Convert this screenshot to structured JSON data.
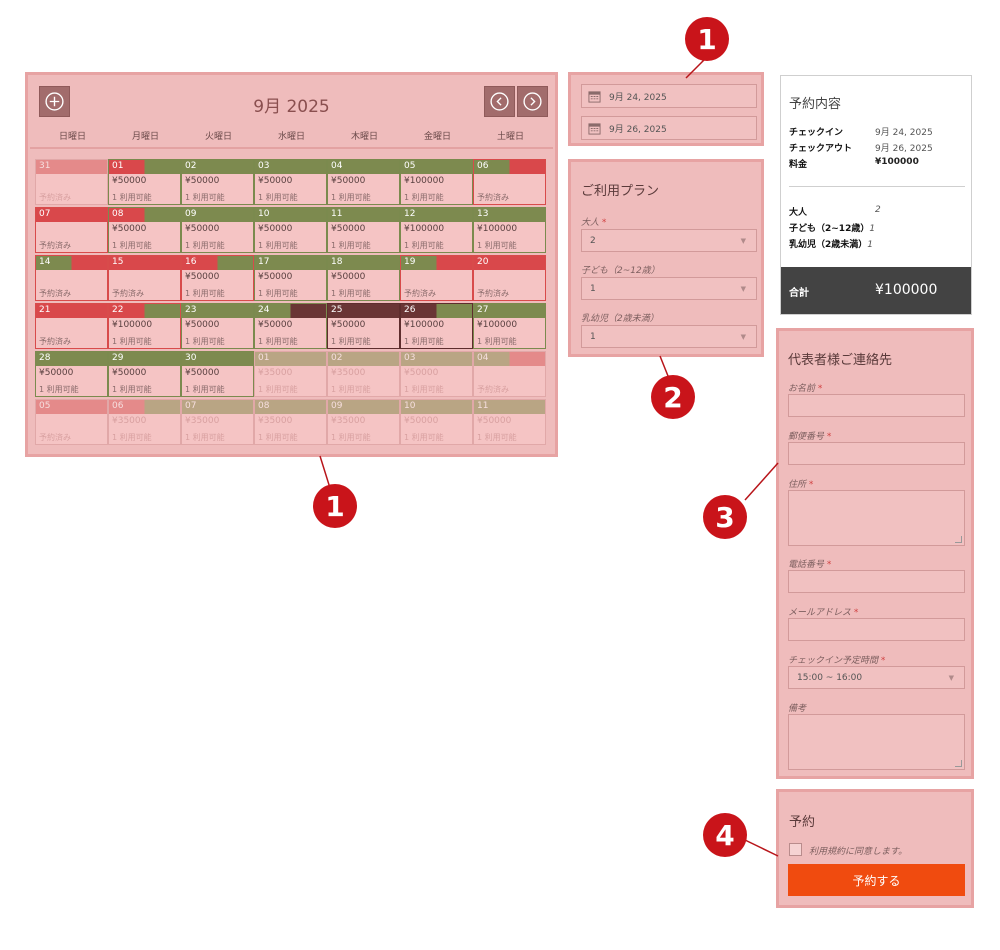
{
  "calendar": {
    "title": "9月 2025",
    "weekdays": [
      "日曜日",
      "月曜日",
      "火曜日",
      "水曜日",
      "木曜日",
      "金曜日",
      "土曜日"
    ],
    "colors": {
      "available": "#7d8a4f",
      "booked": "#d9484b",
      "selected": "#6a3535",
      "out_booked": "#e48a8a",
      "out_available": "#b9a584"
    },
    "weeks": [
      [
        {
          "d": "31",
          "price": "",
          "stat": "予約済み",
          "kind": "out",
          "bar": [
            [
              "out_booked",
              1
            ]
          ]
        },
        {
          "d": "01",
          "price": "¥50000",
          "stat": "1 利用可能",
          "kind": "avail",
          "bar": [
            [
              "booked",
              0.5
            ],
            [
              "available",
              0.5
            ]
          ]
        },
        {
          "d": "02",
          "price": "¥50000",
          "stat": "1 利用可能",
          "kind": "avail",
          "bar": [
            [
              "available",
              1
            ]
          ]
        },
        {
          "d": "03",
          "price": "¥50000",
          "stat": "1 利用可能",
          "kind": "avail",
          "bar": [
            [
              "available",
              1
            ]
          ]
        },
        {
          "d": "04",
          "price": "¥50000",
          "stat": "1 利用可能",
          "kind": "avail",
          "bar": [
            [
              "available",
              1
            ]
          ]
        },
        {
          "d": "05",
          "price": "¥100000",
          "stat": "1 利用可能",
          "kind": "avail",
          "bar": [
            [
              "available",
              1
            ]
          ]
        },
        {
          "d": "06",
          "price": "",
          "stat": "予約済み",
          "kind": "booked",
          "bar": [
            [
              "available",
              0.5
            ],
            [
              "booked",
              0.5
            ]
          ]
        }
      ],
      [
        {
          "d": "07",
          "price": "",
          "stat": "予約済み",
          "kind": "booked",
          "bar": [
            [
              "booked",
              1
            ]
          ]
        },
        {
          "d": "08",
          "price": "¥50000",
          "stat": "1 利用可能",
          "kind": "avail",
          "bar": [
            [
              "booked",
              0.5
            ],
            [
              "available",
              0.5
            ]
          ]
        },
        {
          "d": "09",
          "price": "¥50000",
          "stat": "1 利用可能",
          "kind": "avail",
          "bar": [
            [
              "available",
              1
            ]
          ]
        },
        {
          "d": "10",
          "price": "¥50000",
          "stat": "1 利用可能",
          "kind": "avail",
          "bar": [
            [
              "available",
              1
            ]
          ]
        },
        {
          "d": "11",
          "price": "¥50000",
          "stat": "1 利用可能",
          "kind": "avail",
          "bar": [
            [
              "available",
              1
            ]
          ]
        },
        {
          "d": "12",
          "price": "¥100000",
          "stat": "1 利用可能",
          "kind": "avail",
          "bar": [
            [
              "available",
              1
            ]
          ]
        },
        {
          "d": "13",
          "price": "¥100000",
          "stat": "1 利用可能",
          "kind": "avail",
          "bar": [
            [
              "available",
              1
            ]
          ]
        }
      ],
      [
        {
          "d": "14",
          "price": "",
          "stat": "予約済み",
          "kind": "booked",
          "bar": [
            [
              "available",
              0.5
            ],
            [
              "booked",
              0.5
            ]
          ]
        },
        {
          "d": "15",
          "price": "",
          "stat": "予約済み",
          "kind": "booked",
          "bar": [
            [
              "booked",
              1
            ]
          ]
        },
        {
          "d": "16",
          "price": "¥50000",
          "stat": "1 利用可能",
          "kind": "booked",
          "bar": [
            [
              "booked",
              0.5
            ],
            [
              "available",
              0.5
            ]
          ]
        },
        {
          "d": "17",
          "price": "¥50000",
          "stat": "1 利用可能",
          "kind": "avail",
          "bar": [
            [
              "available",
              1
            ]
          ]
        },
        {
          "d": "18",
          "price": "¥50000",
          "stat": "1 利用可能",
          "kind": "avail",
          "bar": [
            [
              "available",
              1
            ]
          ]
        },
        {
          "d": "19",
          "price": "",
          "stat": "予約済み",
          "kind": "booked",
          "bar": [
            [
              "available",
              0.5
            ],
            [
              "booked",
              0.5
            ]
          ]
        },
        {
          "d": "20",
          "price": "",
          "stat": "予約済み",
          "kind": "booked",
          "bar": [
            [
              "booked",
              1
            ]
          ]
        }
      ],
      [
        {
          "d": "21",
          "price": "",
          "stat": "予約済み",
          "kind": "booked",
          "bar": [
            [
              "booked",
              1
            ]
          ]
        },
        {
          "d": "22",
          "price": "¥100000",
          "stat": "1 利用可能",
          "kind": "booked",
          "bar": [
            [
              "booked",
              0.5
            ],
            [
              "available",
              0.5
            ]
          ]
        },
        {
          "d": "23",
          "price": "¥50000",
          "stat": "1 利用可能",
          "kind": "avail",
          "bar": [
            [
              "available",
              1
            ]
          ]
        },
        {
          "d": "24",
          "price": "¥50000",
          "stat": "1 利用可能",
          "kind": "avail",
          "bar": [
            [
              "available",
              0.5
            ],
            [
              "selected",
              0.5
            ]
          ]
        },
        {
          "d": "25",
          "price": "¥50000",
          "stat": "1 利用可能",
          "kind": "sel",
          "bar": [
            [
              "selected",
              1
            ]
          ]
        },
        {
          "d": "26",
          "price": "¥100000",
          "stat": "1 利用可能",
          "kind": "sel",
          "bar": [
            [
              "selected",
              0.5
            ],
            [
              "available",
              0.5
            ]
          ]
        },
        {
          "d": "27",
          "price": "¥100000",
          "stat": "1 利用可能",
          "kind": "avail",
          "bar": [
            [
              "available",
              1
            ]
          ]
        }
      ],
      [
        {
          "d": "28",
          "price": "¥50000",
          "stat": "1 利用可能",
          "kind": "avail",
          "bar": [
            [
              "available",
              1
            ]
          ]
        },
        {
          "d": "29",
          "price": "¥50000",
          "stat": "1 利用可能",
          "kind": "avail",
          "bar": [
            [
              "available",
              1
            ]
          ]
        },
        {
          "d": "30",
          "price": "¥50000",
          "stat": "1 利用可能",
          "kind": "avail",
          "bar": [
            [
              "available",
              1
            ]
          ]
        },
        {
          "d": "01",
          "price": "¥35000",
          "stat": "1 利用可能",
          "kind": "out",
          "bar": [
            [
              "out_available",
              1
            ]
          ]
        },
        {
          "d": "02",
          "price": "¥35000",
          "stat": "1 利用可能",
          "kind": "out",
          "bar": [
            [
              "out_available",
              1
            ]
          ]
        },
        {
          "d": "03",
          "price": "¥50000",
          "stat": "1 利用可能",
          "kind": "out",
          "bar": [
            [
              "out_available",
              1
            ]
          ]
        },
        {
          "d": "04",
          "price": "",
          "stat": "予約済み",
          "kind": "out",
          "bar": [
            [
              "out_available",
              0.5
            ],
            [
              "out_booked",
              0.5
            ]
          ]
        }
      ],
      [
        {
          "d": "05",
          "price": "",
          "stat": "予約済み",
          "kind": "out",
          "bar": [
            [
              "out_booked",
              1
            ]
          ]
        },
        {
          "d": "06",
          "price": "¥35000",
          "stat": "1 利用可能",
          "kind": "out",
          "bar": [
            [
              "out_booked",
              0.5
            ],
            [
              "out_available",
              0.5
            ]
          ]
        },
        {
          "d": "07",
          "price": "¥35000",
          "stat": "1 利用可能",
          "kind": "out",
          "bar": [
            [
              "out_available",
              1
            ]
          ]
        },
        {
          "d": "08",
          "price": "¥35000",
          "stat": "1 利用可能",
          "kind": "out",
          "bar": [
            [
              "out_available",
              1
            ]
          ]
        },
        {
          "d": "09",
          "price": "¥35000",
          "stat": "1 利用可能",
          "kind": "out",
          "bar": [
            [
              "out_available",
              1
            ]
          ]
        },
        {
          "d": "10",
          "price": "¥50000",
          "stat": "1 利用可能",
          "kind": "out",
          "bar": [
            [
              "out_available",
              1
            ]
          ]
        },
        {
          "d": "11",
          "price": "¥50000",
          "stat": "1 利用可能",
          "kind": "out",
          "bar": [
            [
              "out_available",
              1
            ]
          ]
        }
      ]
    ]
  },
  "dates": {
    "checkin": "9月 24, 2025",
    "checkout": "9月 26, 2025",
    "icon": "calendar-icon"
  },
  "plan": {
    "title": "ご利用プラン",
    "adults_label": "大人",
    "adults_value": "2",
    "children_label": "子ども（2~12歳）",
    "children_value": "1",
    "infants_label": "乳幼児（2歳未満）",
    "infants_value": "1",
    "required_mark": "*"
  },
  "summary": {
    "title": "予約内容",
    "checkin_label": "チェックイン",
    "checkin_value": "9月 24, 2025",
    "checkout_label": "チェックアウト",
    "checkout_value": "9月 26, 2025",
    "price_label": "料金",
    "price_value": "¥100000",
    "adults_label": "大人",
    "adults_value": "2",
    "children_label": "子ども（2~12歳）",
    "children_value": "1",
    "infants_label": "乳幼児（2歳未満）",
    "infants_value": "1",
    "total_label": "合計",
    "total_value": "¥100000"
  },
  "contact": {
    "title": "代表者様ご連絡先",
    "name_label": "お名前",
    "zip_label": "郵便番号",
    "address_label": "住所",
    "phone_label": "電話番号",
    "email_label": "メールアドレス",
    "time_label": "チェックイン予定時間",
    "time_value": "15:00 ~ 16:00",
    "notes_label": "備考"
  },
  "reserve": {
    "title": "予約",
    "agree_label": "利用規約に同意します。",
    "button_label": "予約する"
  },
  "callouts": {
    "c1": "1",
    "c2": "2",
    "c3": "3",
    "c4": "4"
  }
}
